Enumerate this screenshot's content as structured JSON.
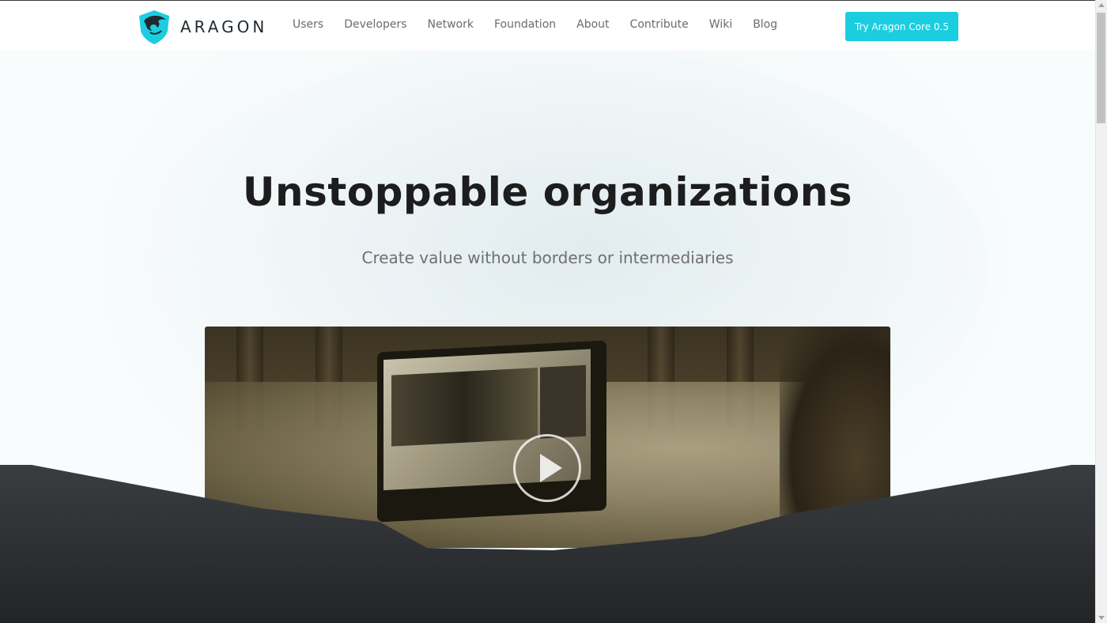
{
  "brand": {
    "name": "ARAGON",
    "accent": "#1ccde0",
    "dark": "#2b2d30"
  },
  "nav": {
    "items": [
      {
        "label": "Users"
      },
      {
        "label": "Developers"
      },
      {
        "label": "Network"
      },
      {
        "label": "Foundation"
      },
      {
        "label": "About"
      },
      {
        "label": "Contribute"
      },
      {
        "label": "Wiki"
      },
      {
        "label": "Blog"
      }
    ],
    "cta_label": "Try Aragon Core 0.5"
  },
  "hero": {
    "title": "Unstoppable organizations",
    "subtitle": "Create value without borders or intermediaries"
  },
  "video": {
    "icon": "play-icon"
  }
}
